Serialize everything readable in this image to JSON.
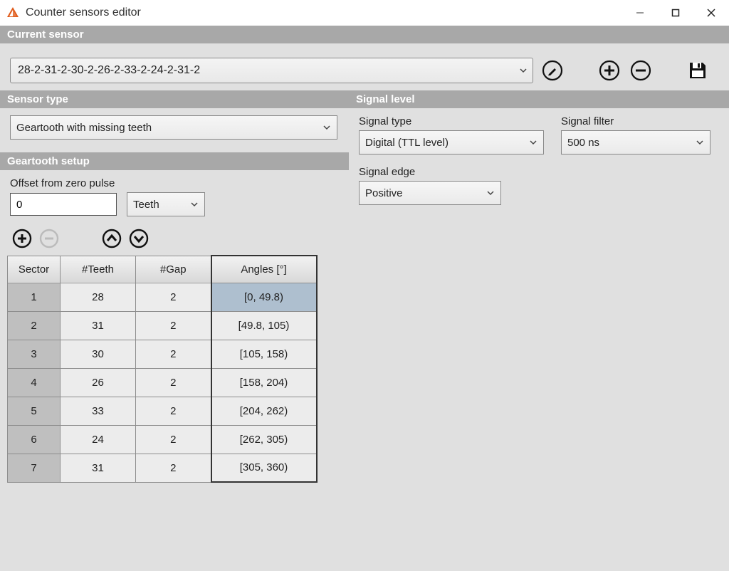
{
  "window": {
    "title": "Counter sensors editor"
  },
  "current_sensor": {
    "header": "Current sensor",
    "value": "28-2-31-2-30-2-26-2-33-2-24-2-31-2"
  },
  "sensor_type": {
    "header": "Sensor type",
    "value": "Geartooth with missing teeth"
  },
  "signal_level": {
    "header": "Signal level",
    "signal_type_label": "Signal type",
    "signal_type_value": "Digital (TTL level)",
    "signal_filter_label": "Signal filter",
    "signal_filter_value": "500 ns",
    "signal_edge_label": "Signal edge",
    "signal_edge_value": "Positive"
  },
  "geartooth": {
    "header": "Geartooth setup",
    "offset_label": "Offset from zero pulse",
    "offset_value": "0",
    "offset_unit": "Teeth"
  },
  "table": {
    "headers": {
      "sector": "Sector",
      "teeth": "#Teeth",
      "gap": "#Gap",
      "angles": "Angles [°]"
    },
    "rows": [
      {
        "sector": "1",
        "teeth": "28",
        "gap": "2",
        "angles": "[0, 49.8)"
      },
      {
        "sector": "2",
        "teeth": "31",
        "gap": "2",
        "angles": "[49.8, 105)"
      },
      {
        "sector": "3",
        "teeth": "30",
        "gap": "2",
        "angles": "[105, 158)"
      },
      {
        "sector": "4",
        "teeth": "26",
        "gap": "2",
        "angles": "[158, 204)"
      },
      {
        "sector": "5",
        "teeth": "33",
        "gap": "2",
        "angles": "[204, 262)"
      },
      {
        "sector": "6",
        "teeth": "24",
        "gap": "2",
        "angles": "[262, 305)"
      },
      {
        "sector": "7",
        "teeth": "31",
        "gap": "2",
        "angles": "[305, 360)"
      }
    ],
    "selected_index": 0
  }
}
